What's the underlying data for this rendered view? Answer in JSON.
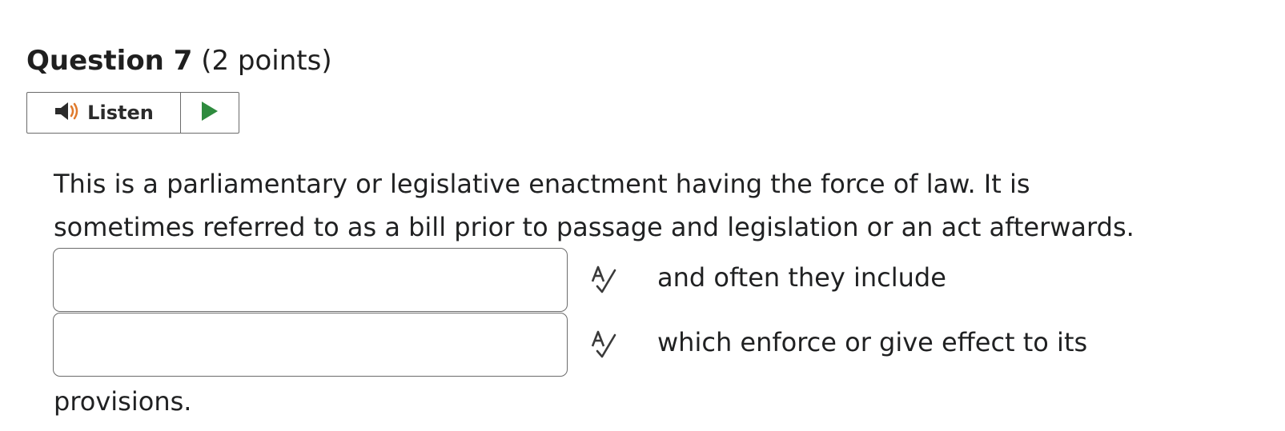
{
  "question": {
    "title": "Question 7",
    "points": "(2 points)"
  },
  "listen": {
    "label": "Listen",
    "icon": "speaker-icon",
    "play_icon": "play-icon",
    "speaker_color": "#2b2b2b",
    "wave_color": "#e07a2c",
    "play_color": "#2e8b3e"
  },
  "body": {
    "line1": "This is a parliamentary or legislative enactment having the force of law. It is",
    "line2": "sometimes referred to as a bill prior to passage and legislation or an act afterwards."
  },
  "blanks": [
    {
      "value": "",
      "placeholder": "",
      "after_text": "and often they include",
      "spell_icon": "spell-check-icon"
    },
    {
      "value": "",
      "placeholder": "",
      "after_text": "which enforce or give effect to its",
      "spell_icon": "spell-check-icon"
    }
  ],
  "trailing_text": "provisions."
}
